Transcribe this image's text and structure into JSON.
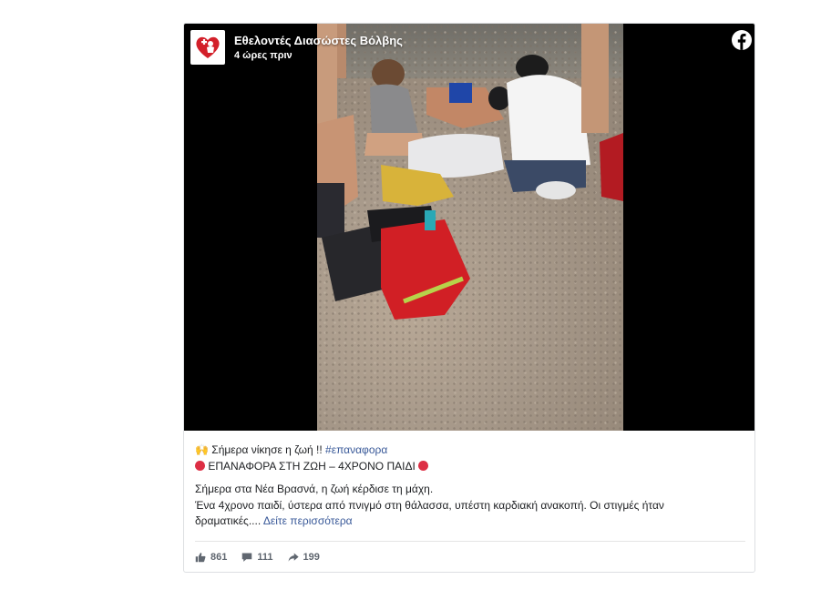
{
  "post": {
    "page_name": "Εθελοντές Διασώστες Βόλβης",
    "timestamp": "4 ώρες πριν",
    "line1_prefix": "🙌 Σήμερα νίκησε η ζωή !! ",
    "hashtag": "#επαναφορα",
    "line2": "ΕΠΑΝΑΦΟΡΑ ΣΤΗ ΖΩΗ – 4ΧΡΟΝΟ ΠΑΙΔΙ",
    "line3": "Σήμερα στα Νέα Βρασνά, η ζωή κέρδισε τη μάχη.",
    "line4": "Ένα 4χρονο παιδί, ύστερα από πνιγμό στη θάλασσα, υπέστη καρδιακή ανακοπή. Οι στιγμές ήταν",
    "line5": "δραματικές.... ",
    "see_more": "Δείτε περισσότερα"
  },
  "stats": {
    "likes": "861",
    "comments": "111",
    "shares": "199"
  },
  "colors": {
    "link": "#385898",
    "text": "#1c1e21",
    "muted": "#606770",
    "red": "#dd2e44"
  },
  "icons": [
    "facebook-icon",
    "like-icon",
    "comment-icon",
    "share-icon",
    "red-circle-emoji",
    "raising-hands-emoji"
  ]
}
